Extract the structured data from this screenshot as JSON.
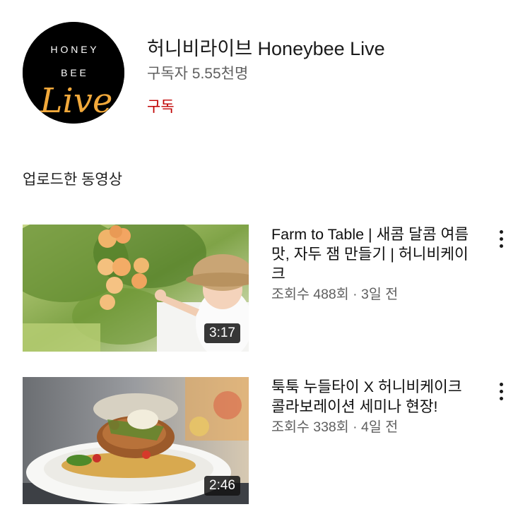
{
  "channel": {
    "name": "허니비라이브 Honeybee Live",
    "subscribers": "구독자 5.55천명",
    "subscribe_label": "구독",
    "avatar": {
      "line1": "H O N E Y",
      "line2": "B E E",
      "script": "Live",
      "accent": "#f2a93b"
    }
  },
  "section_title": "업로드한 동영상",
  "videos": [
    {
      "title": "Farm to Table | 새콤 달콤 여름 맛, 자두 잼 만들기 | 허니비케이크",
      "meta": "조회수 488회 · 3일 전",
      "duration": "3:17",
      "menu_icon": "more-vert-icon"
    },
    {
      "title": "툭툭 누들타이 X 허니비케이크 콜라보레이션 세미나 현장!",
      "meta": "조회수 338회 · 4일 전",
      "duration": "2:46",
      "menu_icon": "more-vert-icon"
    }
  ]
}
